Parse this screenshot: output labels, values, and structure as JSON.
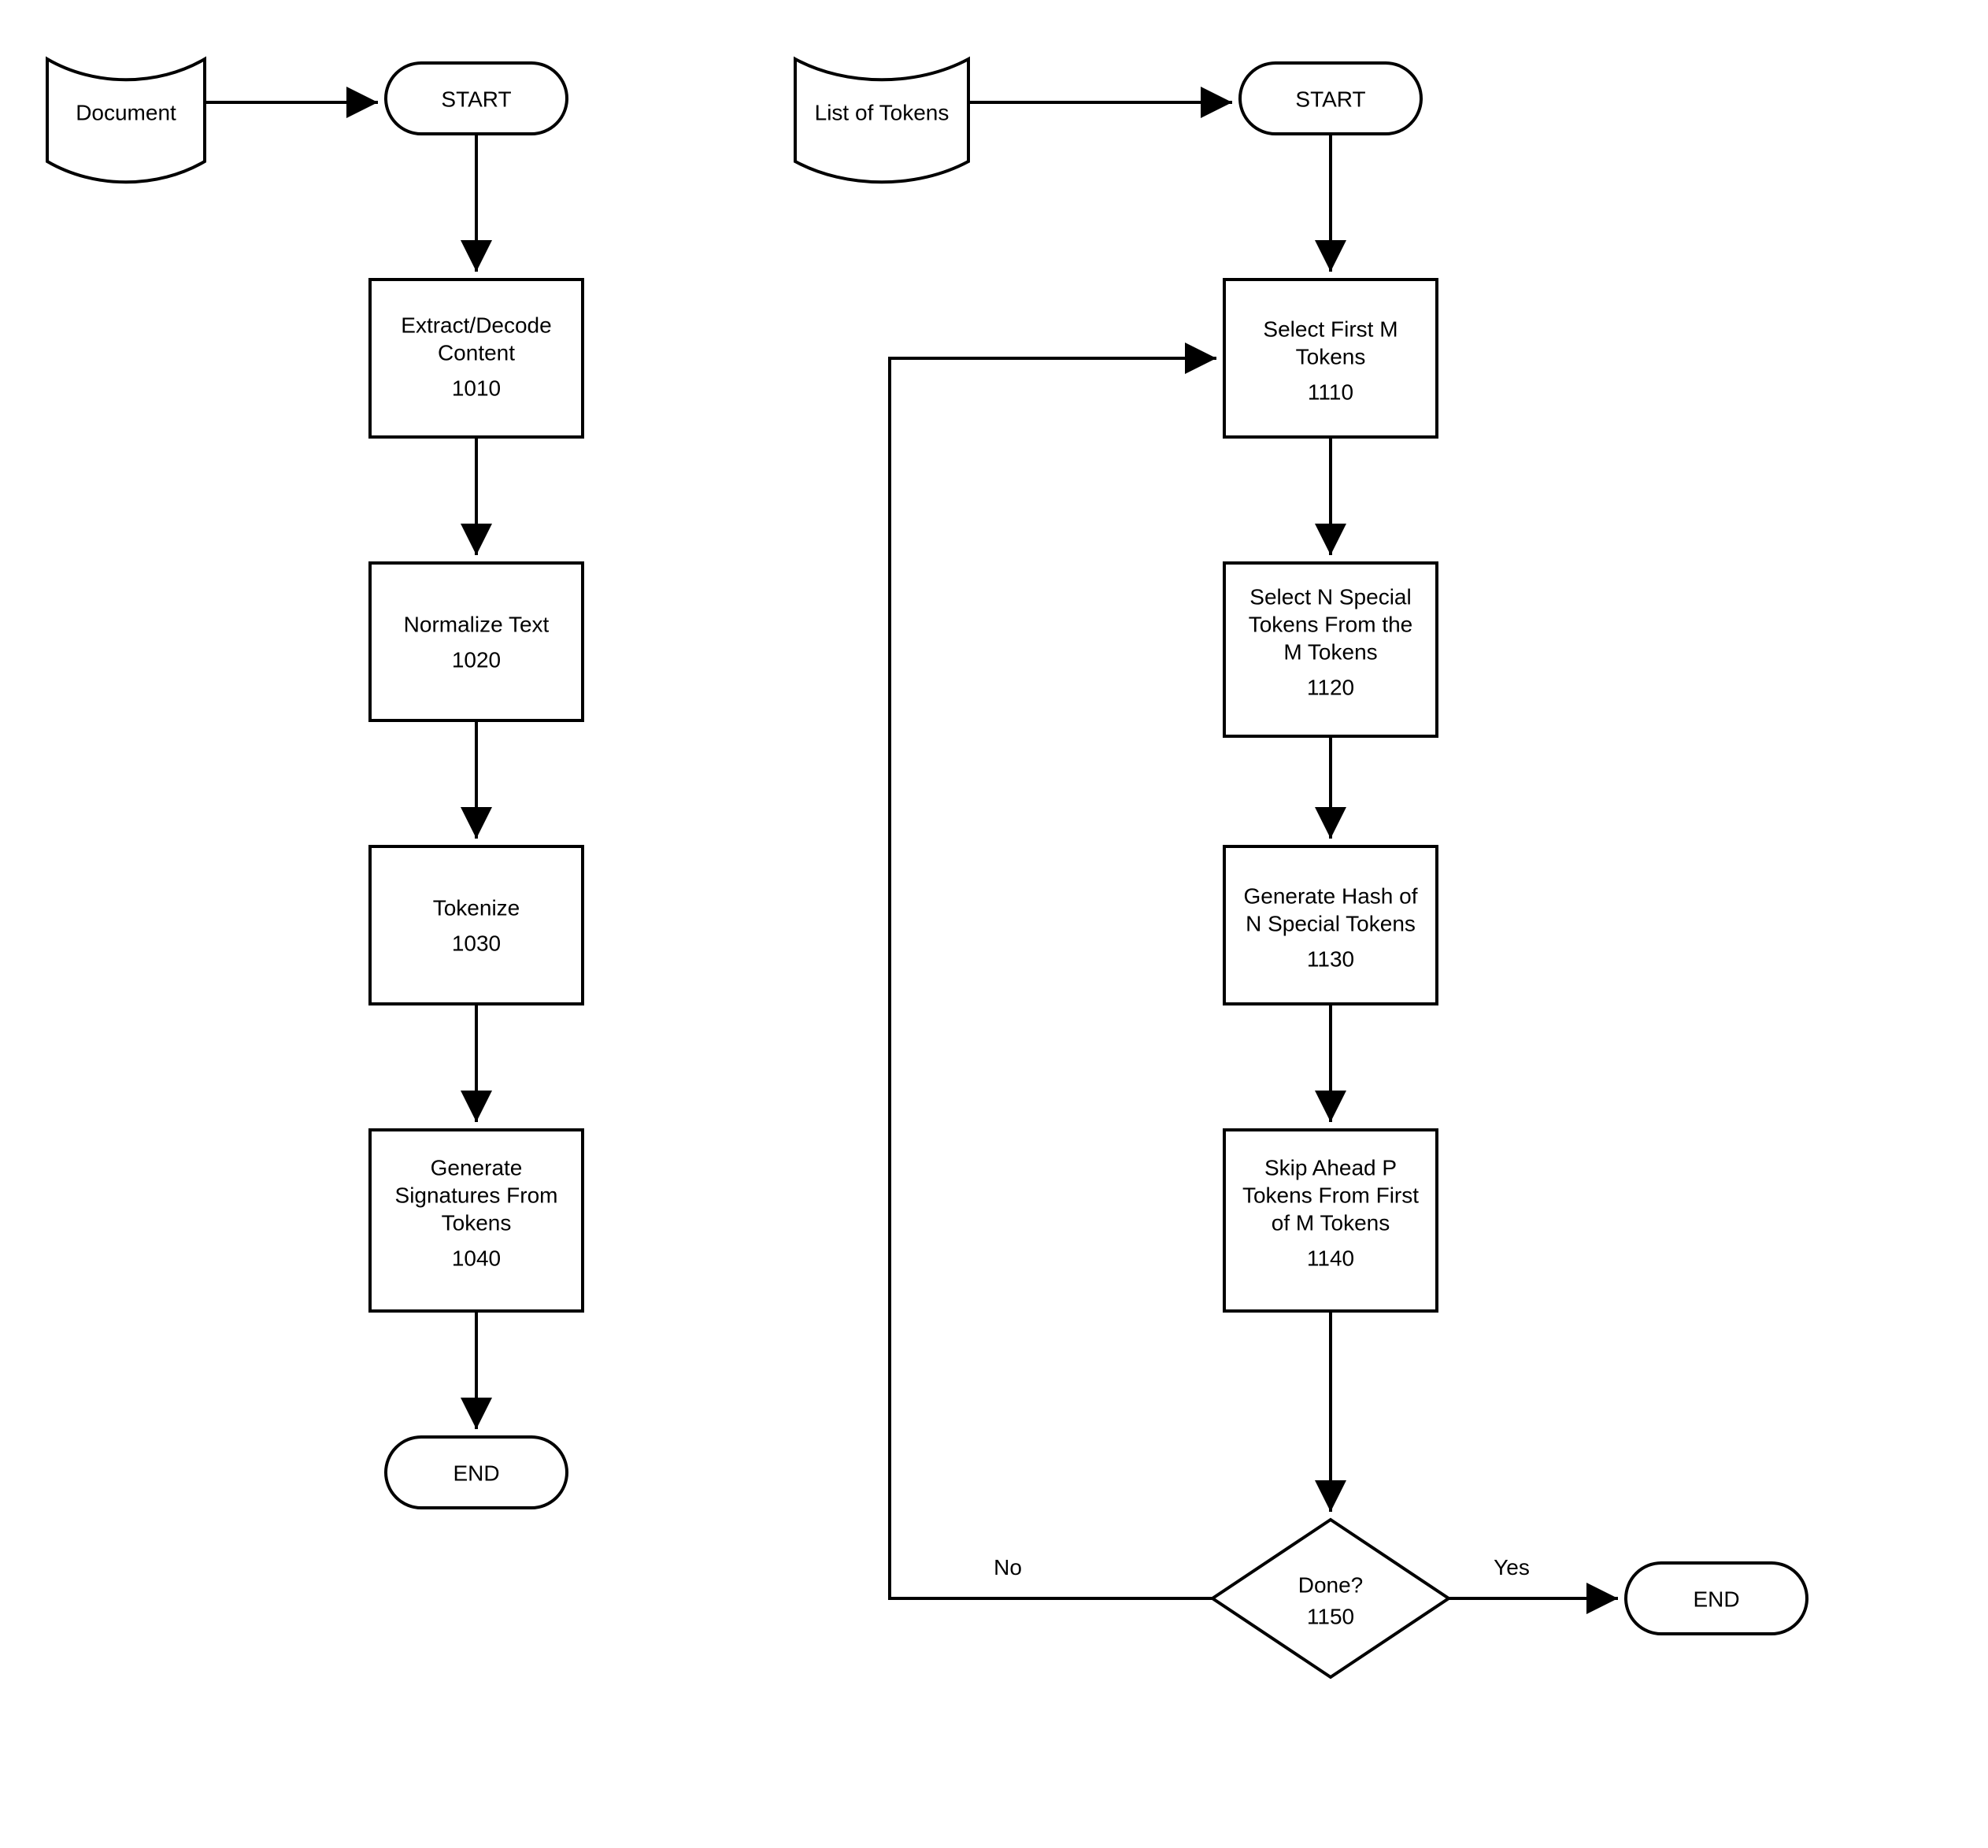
{
  "left": {
    "input_label": "Document",
    "start_label": "START",
    "step1_line1": "Extract/Decode",
    "step1_line2": "Content",
    "step1_ref": "1010",
    "step2_line1": "Normalize Text",
    "step2_ref": "1020",
    "step3_line1": "Tokenize",
    "step3_ref": "1030",
    "step4_line1": "Generate",
    "step4_line2": "Signatures From",
    "step4_line3": "Tokens",
    "step4_ref": "1040",
    "end_label": "END"
  },
  "right": {
    "input_label": "List of Tokens",
    "start_label": "START",
    "step1_line1": "Select First M",
    "step1_line2": "Tokens",
    "step1_ref": "1110",
    "step2_line1": "Select N Special",
    "step2_line2": "Tokens From the",
    "step2_line3": "M Tokens",
    "step2_ref": "1120",
    "step3_line1": "Generate Hash of",
    "step3_line2": "N Special Tokens",
    "step3_ref": "1130",
    "step4_line1": "Skip Ahead P",
    "step4_line2": "Tokens From First",
    "step4_line3": "of M Tokens",
    "step4_ref": "1140",
    "decision_label": "Done?",
    "decision_ref": "1150",
    "no_label": "No",
    "yes_label": "Yes",
    "end_label": "END"
  }
}
